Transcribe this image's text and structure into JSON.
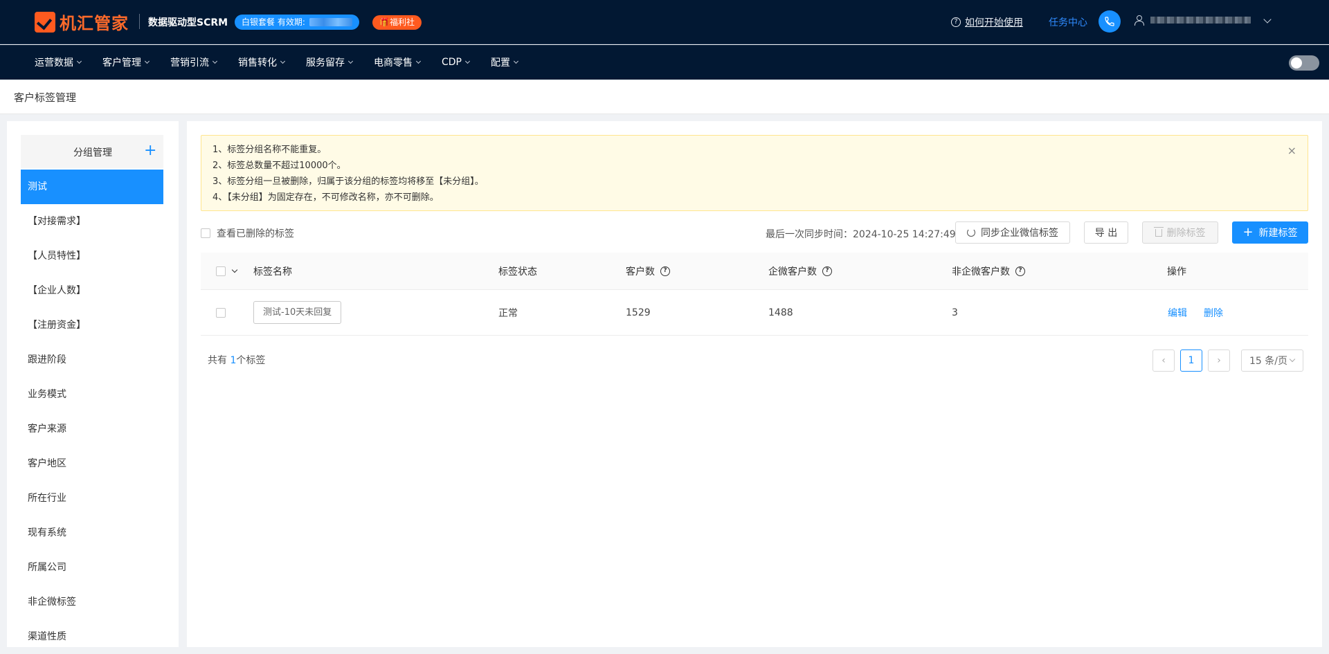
{
  "header": {
    "brand": "机汇管家",
    "subtitle": "数据驱动型SCRM",
    "plan_label": "白银套餐 有效期:",
    "welfare_label": "🎁福利社",
    "help_label": "如何开始使用",
    "task_center": "任务中心"
  },
  "nav": {
    "items": [
      {
        "label": "运营数据"
      },
      {
        "label": "客户管理"
      },
      {
        "label": "营销引流"
      },
      {
        "label": "销售转化"
      },
      {
        "label": "服务留存"
      },
      {
        "label": "电商零售"
      },
      {
        "label": "CDP"
      },
      {
        "label": "配置"
      }
    ]
  },
  "page": {
    "title": "客户标签管理"
  },
  "sidebar": {
    "header": "分组管理",
    "add_icon": "+",
    "items": [
      {
        "label": "测试"
      },
      {
        "label": "【对接需求】"
      },
      {
        "label": "【人员特性】"
      },
      {
        "label": "【企业人数】"
      },
      {
        "label": "【注册资金】"
      },
      {
        "label": "跟进阶段"
      },
      {
        "label": "业务模式"
      },
      {
        "label": "客户来源"
      },
      {
        "label": "客户地区"
      },
      {
        "label": "所在行业"
      },
      {
        "label": "现有系统"
      },
      {
        "label": "所属公司"
      },
      {
        "label": "非企微标签"
      },
      {
        "label": "渠道性质"
      }
    ]
  },
  "notice": {
    "lines": [
      "1、标签分组名称不能重复。",
      "2、标签总数量不超过10000个。",
      "3、标签分组一旦被删除，归属于该分组的标签均将移至【未分组】。",
      "4、【未分组】为固定存在，不可修改名称，亦不可删除。"
    ],
    "close": "×"
  },
  "toolbar": {
    "show_deleted": "查看已删除的标签",
    "sync_time": "最后一次同步时间：2024-10-25 14:27:49",
    "sync_button": "同步企业微信标签",
    "export_button": "导 出",
    "delete_button": "删除标签",
    "new_button": "新建标签"
  },
  "table": {
    "headers": {
      "name": "标签名称",
      "status": "标签状态",
      "customers": "客户数",
      "wecom_customers": "企微客户数",
      "non_wecom_customers": "非企微客户数",
      "actions": "操作"
    },
    "rows": [
      {
        "name": "测试-10天未回复",
        "status": "正常",
        "customers": "1529",
        "wecom_customers": "1488",
        "non_wecom_customers": "3",
        "edit": "编辑",
        "delete": "删除"
      }
    ]
  },
  "footer": {
    "total_prefix": "共有",
    "total_count": "1",
    "total_suffix": "个标签",
    "current_page": "1",
    "page_size": "15 条/页"
  },
  "icons": {
    "help": "help-circle-icon",
    "phone": "phone-icon",
    "user": "user-icon",
    "refresh": "refresh-icon",
    "trash": "trash-icon",
    "plus": "plus-icon"
  },
  "colors": {
    "primary": "#1890ff",
    "header_bg": "#021833",
    "brand_orange": "#ff5a1f",
    "notice_bg": "#fffbe6"
  }
}
